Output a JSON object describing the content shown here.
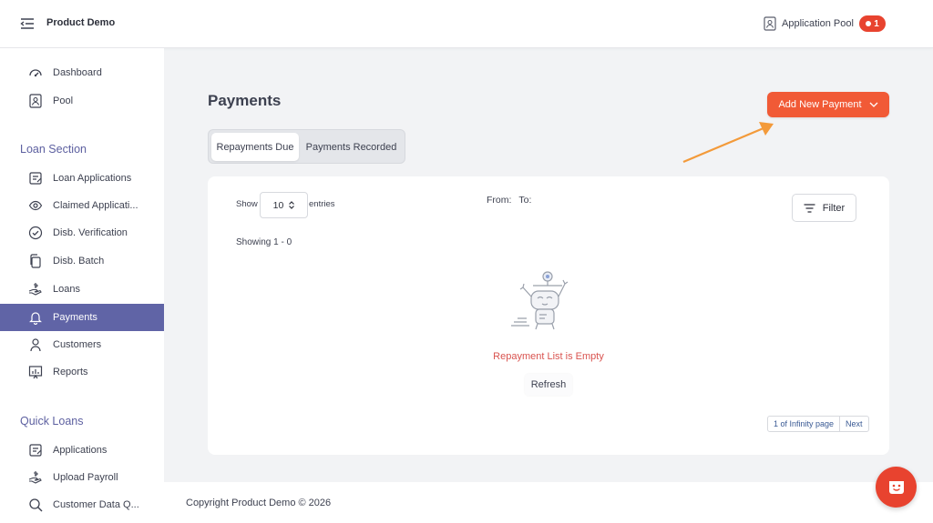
{
  "header": {
    "title": "Product Demo",
    "pool_label": "Application Pool",
    "pool_count": "1"
  },
  "sidebar": {
    "top_items": [
      {
        "label": "Dashboard",
        "icon": "dashboard-icon"
      },
      {
        "label": "Pool",
        "icon": "pool-icon"
      }
    ],
    "loan_section_title": "Loan Section",
    "loan_items": [
      {
        "label": "Loan Applications",
        "icon": "applications-icon"
      },
      {
        "label": "Claimed Applicati...",
        "icon": "eye-icon"
      },
      {
        "label": "Disb. Verification",
        "icon": "check-circle-icon"
      },
      {
        "label": "Disb. Batch",
        "icon": "copy-icon"
      },
      {
        "label": "Loans",
        "icon": "hand-money-icon"
      },
      {
        "label": "Payments",
        "icon": "bell-icon",
        "active": true
      },
      {
        "label": "Customers",
        "icon": "user-icon"
      },
      {
        "label": "Reports",
        "icon": "chart-icon"
      }
    ],
    "quick_section_title": "Quick Loans",
    "quick_items": [
      {
        "label": "Applications",
        "icon": "applications-icon"
      },
      {
        "label": "Upload Payroll",
        "icon": "hand-money-icon"
      },
      {
        "label": "Customer Data Q...",
        "icon": "search-icon"
      }
    ]
  },
  "main": {
    "page_title": "Payments",
    "add_button_label": "Add New Payment",
    "tabs": [
      {
        "label": "Repayments Due",
        "active": true
      },
      {
        "label": "Payments Recorded",
        "active": false
      }
    ],
    "table": {
      "show_label": "Show",
      "entries_value": "10",
      "entries_label": "entries",
      "from_label": "From:",
      "to_label": "To:",
      "filter_label": "Filter",
      "showing_text": "Showing 1 - 0",
      "empty_message": "Repayment List is Empty",
      "refresh_label": "Refresh",
      "pager_info": "1 of Infinity page",
      "pager_next": "Next"
    }
  },
  "footer": {
    "copyright": "Copyright Product Demo © 2026"
  },
  "colors": {
    "accent": "#f15a36",
    "sidebar_active": "#6064a6",
    "section_title": "#5d60a0",
    "badge": "#e8432f",
    "empty_text": "#d9534f"
  }
}
